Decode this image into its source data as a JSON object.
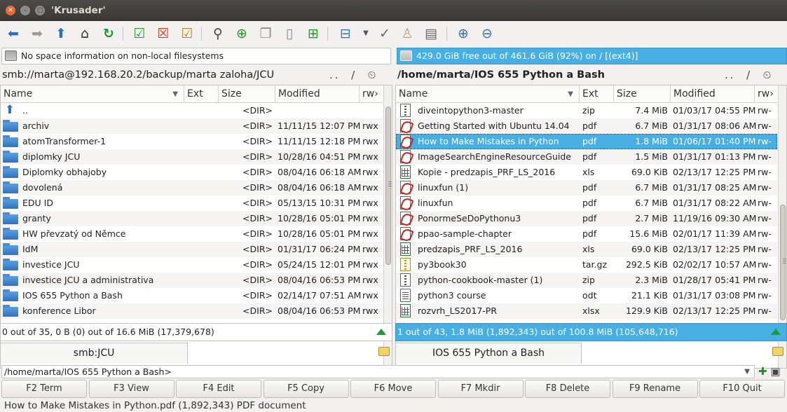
{
  "window": {
    "title": "'Krusader'"
  },
  "toolbar": {
    "icons": [
      "back-arrow",
      "forward-arrow",
      "up-arrow",
      "home",
      "refresh",
      "select-files",
      "unselect-files",
      "compare",
      "search-binoculars",
      "new-folder",
      "copy-files",
      "new-file",
      "new-add",
      "connect-remote",
      "popup-arrow",
      "check-checksum",
      "user",
      "clipboard",
      "zoom-in",
      "zoom-out"
    ]
  },
  "left": {
    "space": "No space information on non-local filesystems",
    "path": "smb://marta@192.168.20.2/backup/marta zaloha/JCU",
    "path_tools": ".. / ⏲ ★",
    "headers": {
      "name": "Name",
      "ext": "Ext",
      "size": "Size",
      "modified": "Modified",
      "perm": "rw›"
    },
    "rows": [
      {
        "name": "..",
        "ext": "",
        "size": "<DIR>",
        "modified": "",
        "perm": "",
        "icon": "up"
      },
      {
        "name": "archiv",
        "ext": "",
        "size": "<DIR>",
        "modified": "11/11/15 12:07 PM",
        "perm": "rwx",
        "icon": "folder"
      },
      {
        "name": "atomTransformer-1",
        "ext": "",
        "size": "<DIR>",
        "modified": "11/11/15 12:18 PM",
        "perm": "rwx",
        "icon": "folder"
      },
      {
        "name": "diplomky JCU",
        "ext": "",
        "size": "<DIR>",
        "modified": "10/28/16 04:51 PM",
        "perm": "rwx",
        "icon": "folder"
      },
      {
        "name": "Diplomky obhajoby",
        "ext": "",
        "size": "<DIR>",
        "modified": "08/04/16 06:18 AM",
        "perm": "rwx",
        "icon": "folder"
      },
      {
        "name": "dovolená",
        "ext": "",
        "size": "<DIR>",
        "modified": "08/04/16 06:18 AM",
        "perm": "rwx",
        "icon": "folder"
      },
      {
        "name": "EDU ID",
        "ext": "",
        "size": "<DIR>",
        "modified": "05/13/15 10:31 PM",
        "perm": "rwx",
        "icon": "folder"
      },
      {
        "name": "granty",
        "ext": "",
        "size": "<DIR>",
        "modified": "10/28/16 05:01 PM",
        "perm": "rwx",
        "icon": "folder"
      },
      {
        "name": "HW převzatý od Němce",
        "ext": "",
        "size": "<DIR>",
        "modified": "10/28/16 05:01 PM",
        "perm": "rwx",
        "icon": "folder"
      },
      {
        "name": "IdM",
        "ext": "",
        "size": "<DIR>",
        "modified": "01/31/17 06:24 PM",
        "perm": "rwx",
        "icon": "folder"
      },
      {
        "name": "investice JCU",
        "ext": "",
        "size": "<DIR>",
        "modified": "05/24/15 12:01 PM",
        "perm": "rwx",
        "icon": "folder"
      },
      {
        "name": "investice JCU a administrativa",
        "ext": "",
        "size": "<DIR>",
        "modified": "08/04/16 06:53 PM",
        "perm": "rwx",
        "icon": "folder"
      },
      {
        "name": "IOS 655 Python a Bash",
        "ext": "",
        "size": "<DIR>",
        "modified": "02/14/17 07:51 AM",
        "perm": "rwx",
        "icon": "folder"
      },
      {
        "name": "konference Libor",
        "ext": "",
        "size": "<DIR>",
        "modified": "08/04/16 06:53 PM",
        "perm": "rwx",
        "icon": "folder"
      }
    ],
    "status": "0 out of 35, 0 B (0) out of 16.6 MiB (17,379,678)",
    "tab": "smb:JCU"
  },
  "right": {
    "space": "429.0 GiB free out of 461.6 GiB (92%) on / [(ext4)]",
    "path": "/home/marta/IOS 655 Python a Bash",
    "path_tools": ".. / ⏲ ★",
    "headers": {
      "name": "Name",
      "ext": "Ext",
      "size": "Size",
      "modified": "Modified",
      "perm": "rw›"
    },
    "rows": [
      {
        "name": "diveintopython3-master",
        "ext": "zip",
        "size": "7.4 MiB",
        "modified": "01/03/17 04:55 PM",
        "perm": "rw-",
        "icon": "zip"
      },
      {
        "name": "Getting Started with Ubuntu 14.04",
        "ext": "pdf",
        "size": "6.7 MiB",
        "modified": "01/31/17 08:06 AM",
        "perm": "rw-",
        "icon": "pdf"
      },
      {
        "name": "How to Make Mistakes in Python",
        "ext": "pdf",
        "size": "1.8 MiB",
        "modified": "01/06/17 01:40 PM",
        "perm": "rw-",
        "icon": "pdf",
        "selected": true
      },
      {
        "name": "ImageSearchEngineResourceGuide",
        "ext": "pdf",
        "size": "1.5 MiB",
        "modified": "01/31/17 01:13 PM",
        "perm": "rw-",
        "icon": "pdf"
      },
      {
        "name": "Kopie - predzapis_PRF_LS_2016",
        "ext": "xls",
        "size": "69.0 KiB",
        "modified": "02/13/17 12:25 PM",
        "perm": "rw-",
        "icon": "xls"
      },
      {
        "name": "linuxfun (1)",
        "ext": "pdf",
        "size": "6.7 MiB",
        "modified": "01/31/17 08:25 AM",
        "perm": "rw-",
        "icon": "pdf"
      },
      {
        "name": "linuxfun",
        "ext": "pdf",
        "size": "6.7 MiB",
        "modified": "01/31/17 08:22 AM",
        "perm": "rw-",
        "icon": "pdf"
      },
      {
        "name": "PonormeSeDoPythonu3",
        "ext": "pdf",
        "size": "2.7 MiB",
        "modified": "11/19/16 09:30 AM",
        "perm": "rw-",
        "icon": "pdf"
      },
      {
        "name": "ppao-sample-chapter",
        "ext": "pdf",
        "size": "15.6 MiB",
        "modified": "02/01/17 11:39 AM",
        "perm": "rw-",
        "icon": "pdf"
      },
      {
        "name": "predzapis_PRF_LS_2016",
        "ext": "xls",
        "size": "69.0 KiB",
        "modified": "02/13/17 12:25 PM",
        "perm": "rw-",
        "icon": "xls"
      },
      {
        "name": "py3book30",
        "ext": "tar.gz",
        "size": "292.5 KiB",
        "modified": "02/02/17 10:57 AM",
        "perm": "rw-",
        "icon": "tar"
      },
      {
        "name": "python-cookbook-master (1)",
        "ext": "zip",
        "size": "2.3 MiB",
        "modified": "01/28/17 05:41 PM",
        "perm": "rw-",
        "icon": "zip"
      },
      {
        "name": "python3 course",
        "ext": "odt",
        "size": "21.1 KiB",
        "modified": "01/31/17 03:08 PM",
        "perm": "rw-",
        "icon": "odt"
      },
      {
        "name": "rozvrh_LS2017-PR",
        "ext": "xlsx",
        "size": "129.9 KiB",
        "modified": "02/13/17 12:25 PM",
        "perm": "rw-",
        "icon": "xls"
      }
    ],
    "status": "1 out of 43, 1.8 MiB (1,892,343) out of 100.8 MiB (105,648,716)",
    "tab": "IOS 655 Python a Bash"
  },
  "cmdline": {
    "value": "/home/marta/IOS 655 Python a Bash>"
  },
  "fkeys": [
    "F2 Term",
    "F3 View",
    "F4 Edit",
    "F5 Copy",
    "F6 Move",
    "F7 Mkdir",
    "F8 Delete",
    "F9 Rename",
    "F10 Quit"
  ],
  "statusbar": "How to Make Mistakes in Python.pdf (1,892,343)  PDF document",
  "colors": {
    "accent": "#49aee1",
    "titlebar": "#3c3b37",
    "background": "#f2f1f0"
  }
}
